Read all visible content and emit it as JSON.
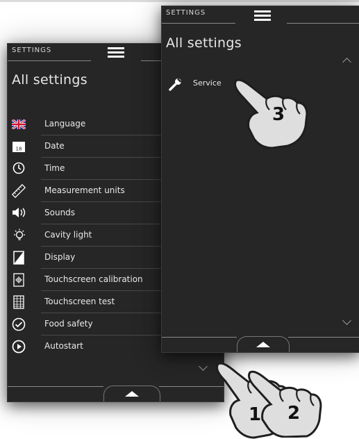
{
  "screen_main": {
    "crumb": "SETTINGS",
    "title": "All settings",
    "items": [
      {
        "label": "Language",
        "icon": "uk-flag-icon"
      },
      {
        "label": "Date",
        "icon": "calendar-icon"
      },
      {
        "label": "Time",
        "icon": "clock-icon"
      },
      {
        "label": "Measurement units",
        "icon": "ruler-icon"
      },
      {
        "label": "Sounds",
        "icon": "speaker-icon"
      },
      {
        "label": "Cavity light",
        "icon": "light-bulb-icon"
      },
      {
        "label": "Display",
        "icon": "display-icon"
      },
      {
        "label": "Touchscreen calibration",
        "icon": "calibration-icon"
      },
      {
        "label": "Touchscreen test",
        "icon": "grid-icon"
      },
      {
        "label": "Food safety",
        "icon": "check-circle-icon"
      },
      {
        "label": "Autostart",
        "icon": "play-circle-icon"
      }
    ],
    "calendar_day": "18"
  },
  "screen_service": {
    "crumb": "SETTINGS",
    "title": "All settings",
    "items": [
      {
        "label": "Service",
        "icon": "wrench-icon"
      }
    ]
  },
  "gestures": {
    "step1": "1",
    "step2": "2",
    "step3": "3"
  }
}
